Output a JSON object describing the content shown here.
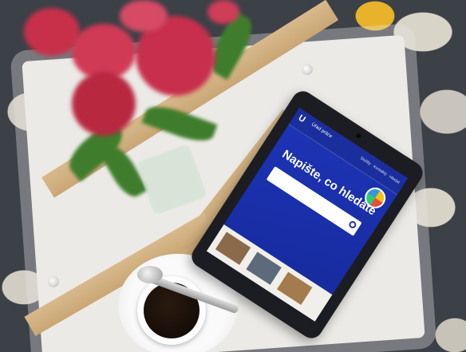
{
  "tablet": {
    "site": {
      "logo_glyph": "U",
      "logo_text": "Úřad práce",
      "nav": "Služby · Kontakty · Hledat",
      "hero_title": "Napište, co hledáte",
      "search_placeholder": ""
    }
  },
  "colors": {
    "site_blue": "#1d34b8",
    "rug_dark": "#3c4047",
    "rug_yellow": "#e8b22a",
    "flower_red": "#c8304a",
    "wood": "#d8b98c"
  }
}
